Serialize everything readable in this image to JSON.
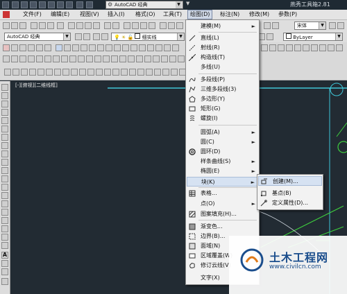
{
  "titlebar": {
    "workspace_combo": "AutoCAD 经典",
    "app_title": "燕秀工具箱2.81"
  },
  "menubar": {
    "items": [
      "文件(F)",
      "编辑(E)",
      "视图(V)",
      "插入(I)",
      "格式(O)",
      "工具(T)",
      "绘图(D)",
      "标注(N)",
      "修改(M)",
      "参数(P)"
    ],
    "active_index": 6
  },
  "toolbars": {
    "workspace_combo": "AutoCAD 经典",
    "layer_combo": "细实线",
    "bylayer_combo": "ByLayer",
    "font_combo": "宋体"
  },
  "viewport": {
    "label": "[-][俯视][二维线框]"
  },
  "draw_menu": {
    "items": [
      {
        "label": "建模(M)",
        "submenu": true,
        "icon": "none"
      },
      {
        "label": "直线(L)",
        "icon": "line-icon"
      },
      {
        "label": "射线(R)",
        "icon": "ray-icon"
      },
      {
        "label": "构造线(T)",
        "icon": "xline-icon"
      },
      {
        "label": "多线(U)",
        "icon": "none"
      },
      {
        "label": "多段线(P)",
        "icon": "polyline-icon"
      },
      {
        "label": "三维多段线(3)",
        "icon": "3dpolyline-icon"
      },
      {
        "label": "多边形(Y)",
        "icon": "polygon-icon"
      },
      {
        "label": "矩形(G)",
        "icon": "rectangle-icon"
      },
      {
        "label": "螺旋(I)",
        "icon": "helix-icon"
      },
      {
        "label": "圆弧(A)",
        "submenu": true,
        "icon": "none"
      },
      {
        "label": "圆(C)",
        "submenu": true,
        "icon": "none"
      },
      {
        "label": "圆环(D)",
        "icon": "donut-icon"
      },
      {
        "label": "样条曲线(S)",
        "submenu": true,
        "icon": "none"
      },
      {
        "label": "椭圆(E)",
        "submenu": true,
        "icon": "none"
      },
      {
        "label": "块(K)",
        "submenu": true,
        "icon": "none",
        "highlighted": true
      },
      {
        "label": "表格...",
        "icon": "table-icon"
      },
      {
        "label": "点(O)",
        "submenu": true,
        "icon": "none"
      },
      {
        "label": "图案填充(H)...",
        "icon": "hatch-icon"
      },
      {
        "label": "渐变色...",
        "icon": "gradient-icon"
      },
      {
        "label": "边界(B)...",
        "icon": "boundary-icon"
      },
      {
        "label": "面域(N)",
        "icon": "region-icon"
      },
      {
        "label": "区域覆盖(W)",
        "icon": "wipeout-icon"
      },
      {
        "label": "修订云线(V)",
        "icon": "revcloud-icon"
      },
      {
        "label": "文字(X)",
        "submenu": true,
        "icon": "none"
      }
    ]
  },
  "block_submenu": {
    "items": [
      {
        "label": "创建(M)...",
        "icon": "create-block-icon",
        "highlighted": true
      },
      {
        "label": "基点(B)",
        "icon": "base-point-icon"
      },
      {
        "label": "定义属性(D)...",
        "icon": "define-attribute-icon"
      }
    ]
  },
  "watermark": {
    "title": "土木工程网",
    "url": "www.civilcn.com"
  },
  "colors": {
    "drawing_bg": "#222b33",
    "cyan_lines": "#3fc6d8",
    "green_lines": "#3ecf3e",
    "menu_highlight": "#d6e2f2",
    "watermark_blue": "#1a4d8c"
  }
}
